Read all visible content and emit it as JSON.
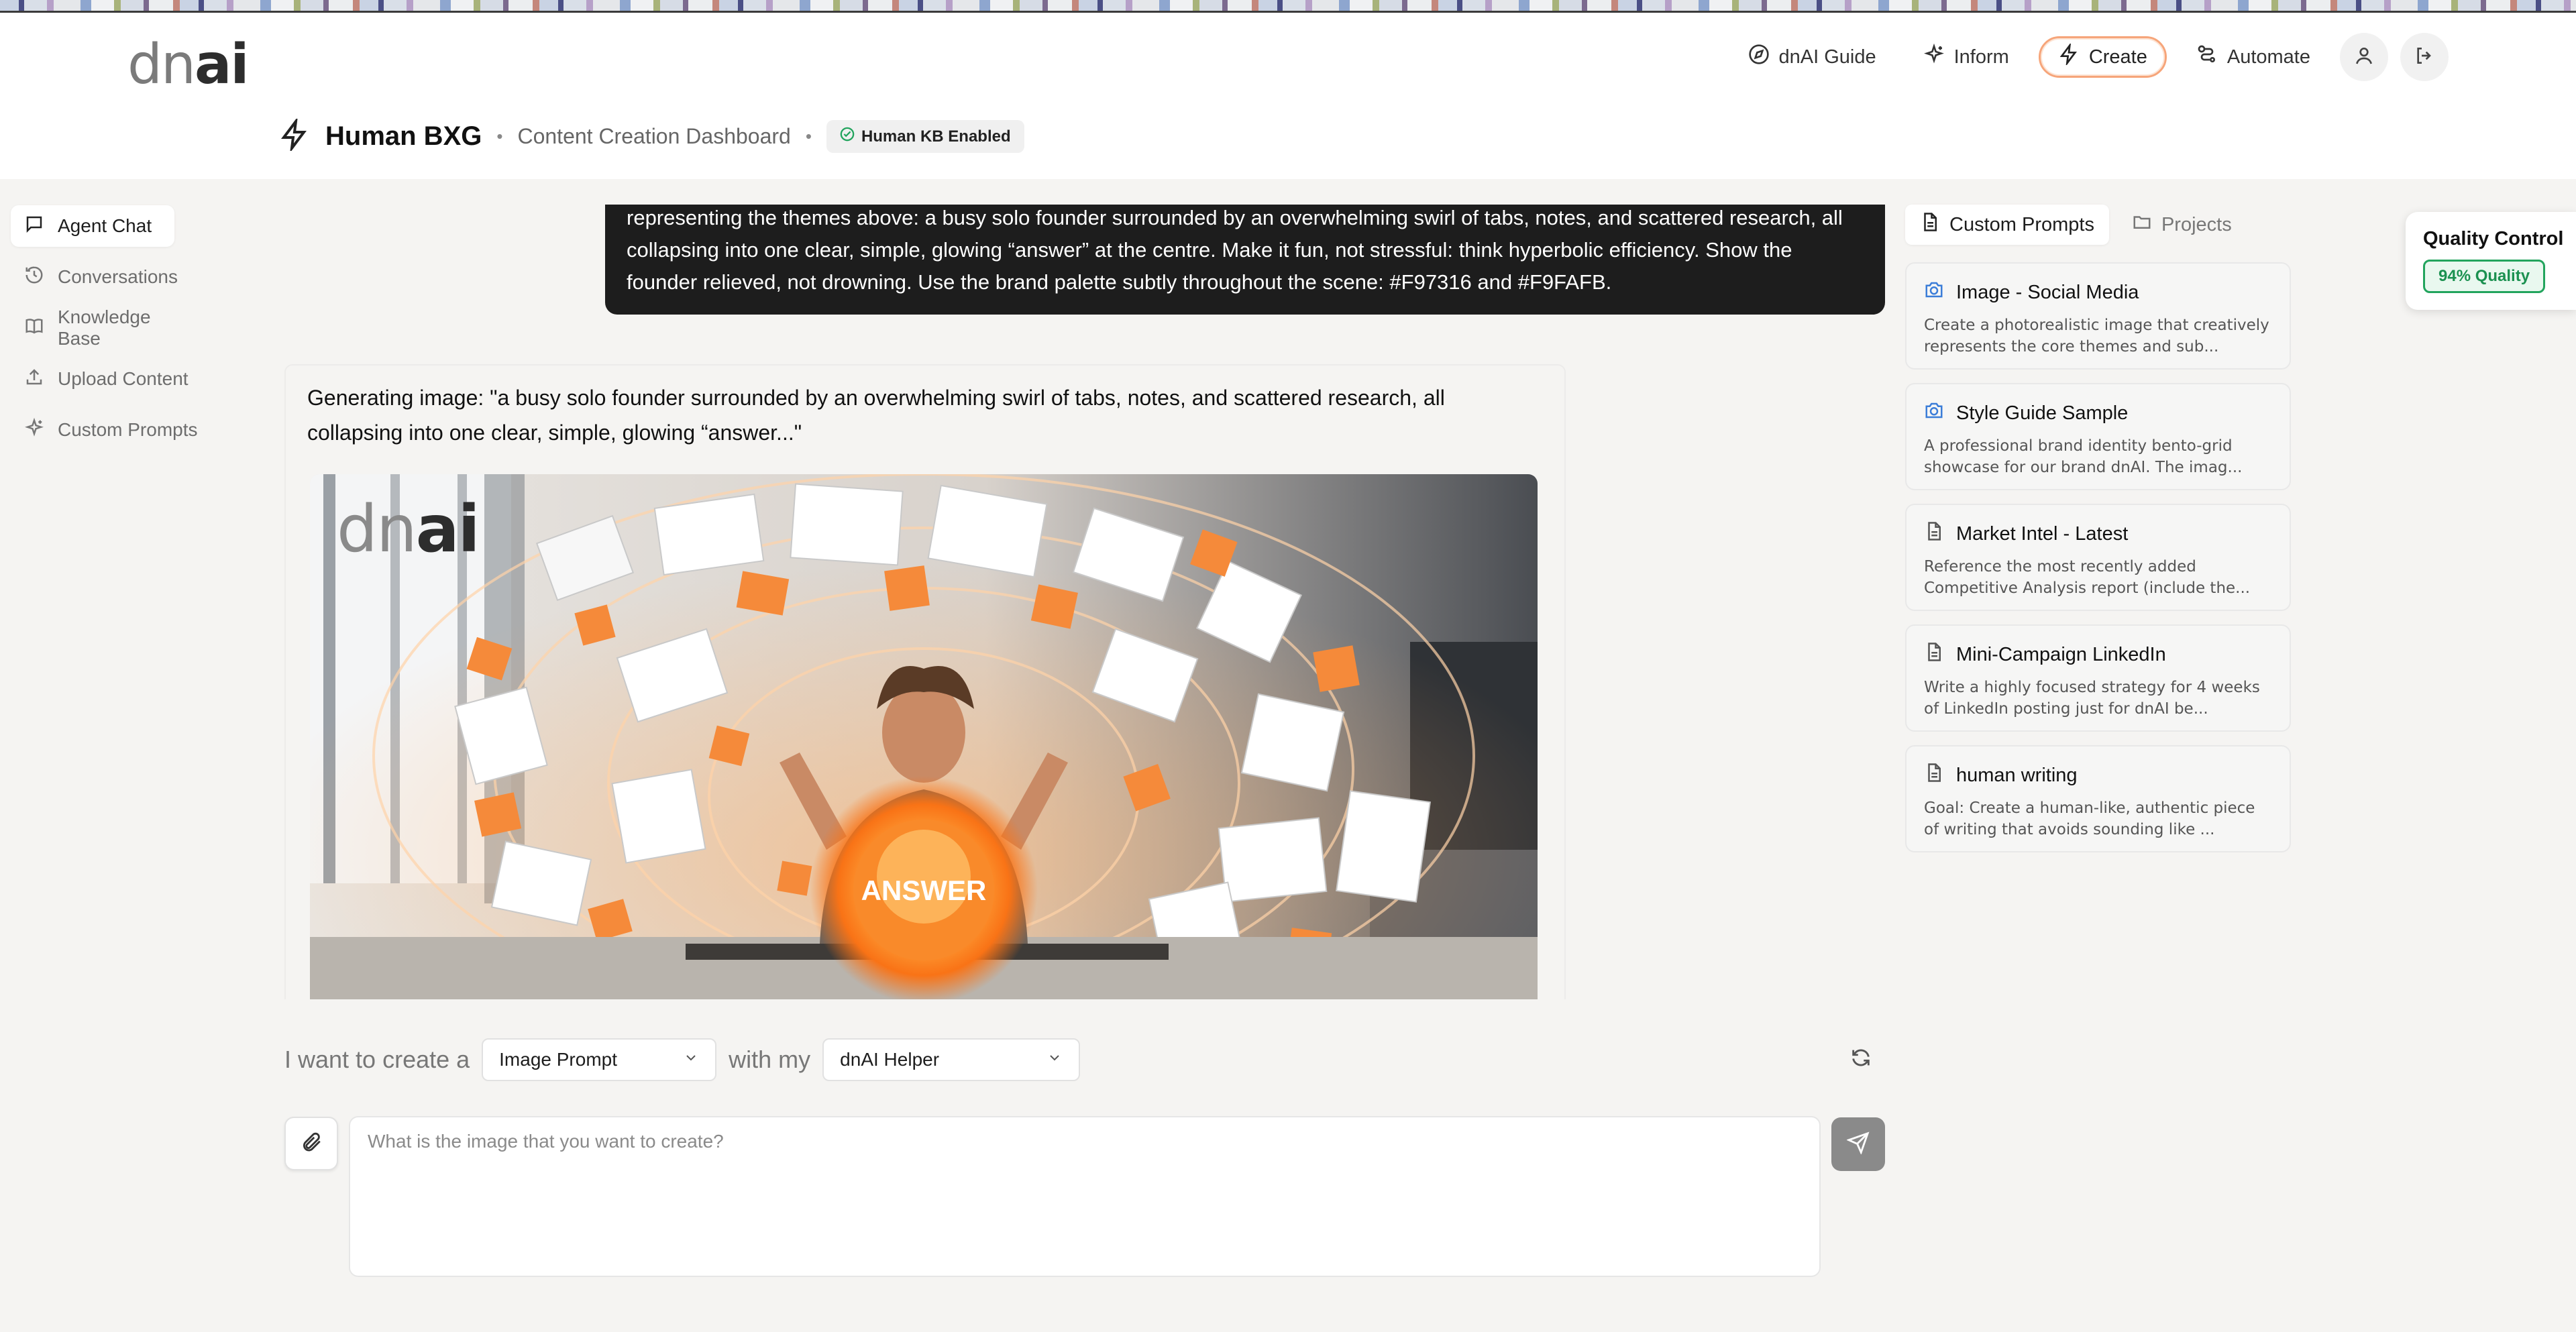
{
  "header": {
    "logo_light": "dn",
    "logo_bold": "ai",
    "nav": [
      {
        "label": "dnAI Guide"
      },
      {
        "label": "Inform"
      },
      {
        "label": "Create"
      },
      {
        "label": "Automate"
      }
    ]
  },
  "page": {
    "title": "Human BXG",
    "separator": "•",
    "subtitle": "Content Creation Dashboard",
    "badge": "Human KB Enabled"
  },
  "sidebar": {
    "items": [
      {
        "label": "Agent Chat",
        "icon": "message-square-icon"
      },
      {
        "label": "Conversations",
        "icon": "history-icon"
      },
      {
        "label": "Knowledge Base",
        "icon": "book-icon"
      },
      {
        "label": "Upload Content",
        "icon": "upload-icon"
      },
      {
        "label": "Custom Prompts",
        "icon": "sparkles-icon"
      }
    ]
  },
  "chat": {
    "user_message": "representing the themes above: a busy solo founder surrounded by an overwhelming swirl of tabs, notes, and scattered research, all collapsing into one clear, simple, glowing “answer” at the centre. Make it fun, not stressful: think hyperbolic efficiency. Show the founder relieved, not drowning. Use the brand palette subtly throughout the scene: #F97316 and #F9FAFB.",
    "assistant_message": "Generating image: \"a busy solo founder surrounded by an overwhelming swirl of tabs, notes, and scattered research, all collapsing into one clear, simple, glowing “answer...\"",
    "image": {
      "logo_light": "dn",
      "logo_bold": "ai",
      "orb_text": "ANSWER",
      "colors": {
        "accent": "#F97316",
        "light": "#F9FAFB"
      }
    }
  },
  "composer": {
    "lead_text": "I want to create a",
    "content_type": "Image Prompt",
    "middle_text": "with my",
    "helper": "dnAI Helper",
    "placeholder": "What is the image that you want to create?",
    "value": ""
  },
  "right_panel": {
    "tabs": [
      {
        "label": "Custom Prompts"
      },
      {
        "label": "Projects"
      }
    ],
    "cards": [
      {
        "title": "Image - Social Media",
        "desc": "Create a photorealistic image that creatively represents the core themes and sub...",
        "icon": "camera-icon"
      },
      {
        "title": "Style Guide Sample",
        "desc": "A professional brand identity bento-grid showcase for our brand dnAI. The imag...",
        "icon": "camera-icon"
      },
      {
        "title": "Market Intel - Latest",
        "desc": "Reference the most recently added Competitive Analysis report (include the...",
        "icon": "document-icon"
      },
      {
        "title": "Mini-Campaign LinkedIn",
        "desc": "Write a highly focused strategy for 4 weeks of LinkedIn posting just for dnAI be...",
        "icon": "document-icon"
      },
      {
        "title": "human writing",
        "desc": "Goal: Create a human-like, authentic piece of writing that avoids sounding like ...",
        "icon": "document-icon"
      }
    ]
  },
  "quality_control": {
    "title": "Quality Control",
    "badge": "94% Quality"
  },
  "colors": {
    "accent": "#F97316",
    "quality_green": "#22A45D"
  }
}
